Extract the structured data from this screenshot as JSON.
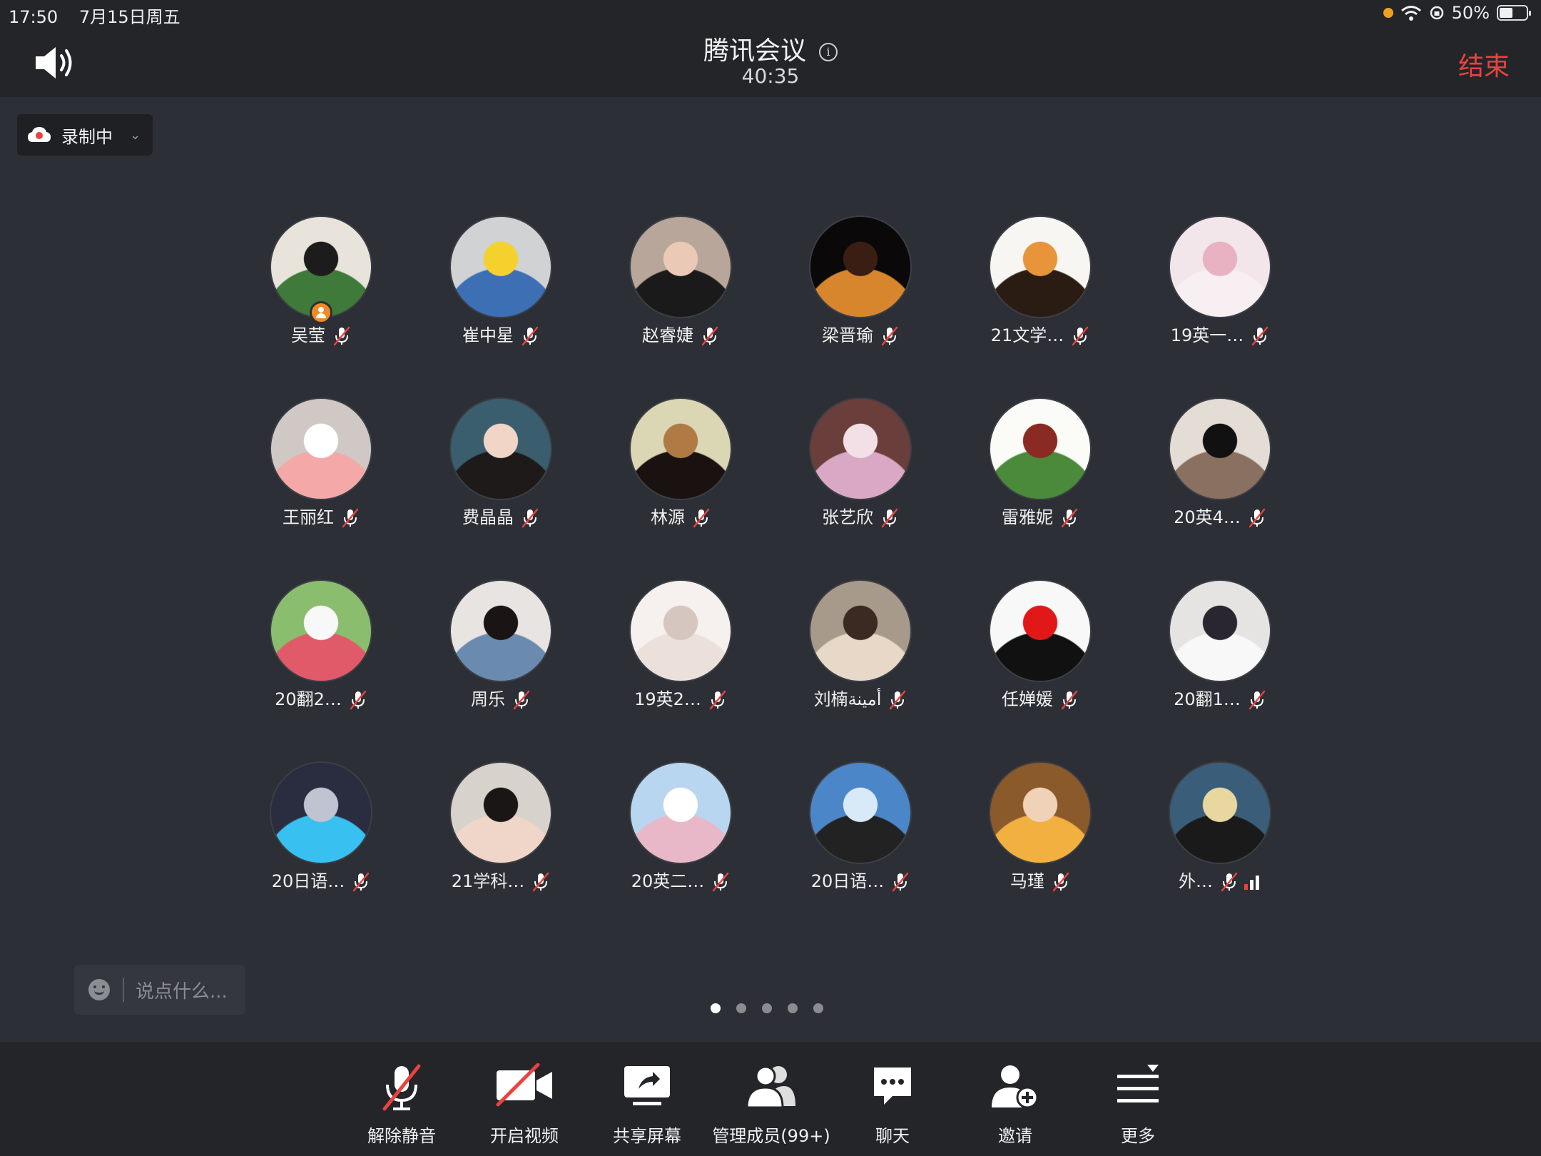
{
  "status_bar": {
    "time": "17:50",
    "date": "7月15日周五",
    "battery": "50%"
  },
  "header": {
    "title": "腾讯会议",
    "timer": "40:35",
    "end_label": "结束"
  },
  "recording": {
    "label": "录制中"
  },
  "participants": [
    {
      "name": "吴莹",
      "host": true,
      "colors": [
        "#e8e4dc",
        "#1c1c1c",
        "#3f7a3a"
      ]
    },
    {
      "name": "崔中星",
      "colors": [
        "#d0d2d4",
        "#f4d12c",
        "#3d6fb5"
      ]
    },
    {
      "name": "赵睿婕",
      "colors": [
        "#b8a69a",
        "#eac9b6",
        "#1a1a1a"
      ]
    },
    {
      "name": "梁晋瑜",
      "colors": [
        "#0a0808",
        "#3a1e14",
        "#d8862e"
      ]
    },
    {
      "name": "21文学…",
      "colors": [
        "#f8f6f2",
        "#e8943a",
        "#2a1c12"
      ]
    },
    {
      "name": "19英一…",
      "colors": [
        "#f2e6ea",
        "#e8b2c2",
        "#f8eff2"
      ]
    },
    {
      "name": "王丽红",
      "colors": [
        "#cfc8c4",
        "#ffffff",
        "#f4a8a8"
      ]
    },
    {
      "name": "费晶晶",
      "colors": [
        "#3a5e6e",
        "#f1d6c8",
        "#1e1a1a"
      ]
    },
    {
      "name": "林源",
      "colors": [
        "#dbd6b4",
        "#b07a44",
        "#1a1210"
      ]
    },
    {
      "name": "张艺欣",
      "colors": [
        "#6a3e3a",
        "#f3dfe6",
        "#d8a8c4"
      ]
    },
    {
      "name": "雷雅妮",
      "colors": [
        "#fbfbf8",
        "#8a2a22",
        "#4a8a3a"
      ]
    },
    {
      "name": "20英4…",
      "colors": [
        "#e4ddd6",
        "#111111",
        "#8a7060"
      ]
    },
    {
      "name": "20翻2…",
      "colors": [
        "#8abd6e",
        "#f8f8f8",
        "#e05a6a"
      ]
    },
    {
      "name": "周乐",
      "colors": [
        "#e8e4e2",
        "#1a1414",
        "#6a8ab0"
      ]
    },
    {
      "name": "19英2…",
      "colors": [
        "#f6f1ee",
        "#d6c6c0",
        "#ebe0da"
      ]
    },
    {
      "name": "刘楠أمينة",
      "colors": [
        "#a89a8a",
        "#3a2a22",
        "#e8d8c8"
      ]
    },
    {
      "name": "任婵媛",
      "colors": [
        "#f8f8f8",
        "#e21818",
        "#111111"
      ]
    },
    {
      "name": "20翻1…",
      "colors": [
        "#e6e4e2",
        "#2a2630",
        "#f8f8f8"
      ]
    },
    {
      "name": "20日语…",
      "colors": [
        "#2a2d40",
        "#c0c4d0",
        "#38c0f0"
      ]
    },
    {
      "name": "21学科…",
      "colors": [
        "#d8d2cc",
        "#1a1616",
        "#f0d6c8"
      ]
    },
    {
      "name": "20英二…",
      "colors": [
        "#b8d6f0",
        "#ffffff",
        "#e8b8c8"
      ]
    },
    {
      "name": "20日语…",
      "colors": [
        "#4a86c8",
        "#d8eaf8",
        "#222222"
      ]
    },
    {
      "name": "马瑾",
      "colors": [
        "#8a5a2a",
        "#f0d2b8",
        "#f2b040"
      ]
    },
    {
      "name": "外…",
      "colors": [
        "#3a5e7a",
        "#e8d8a0",
        "#1a1a1a"
      ],
      "signal": true
    }
  ],
  "comment": {
    "placeholder": "说点什么..."
  },
  "pagination": {
    "pages": 5,
    "current": 1
  },
  "toolbar": {
    "unmute": "解除静音",
    "video": "开启视频",
    "share": "共享屏幕",
    "members": "管理成员(99+)",
    "chat": "聊天",
    "invite": "邀请",
    "more": "更多"
  },
  "colors": {
    "end_red": "#e8433f",
    "accent_blue": "#2f7df6",
    "mute_red": "#e8433f"
  }
}
